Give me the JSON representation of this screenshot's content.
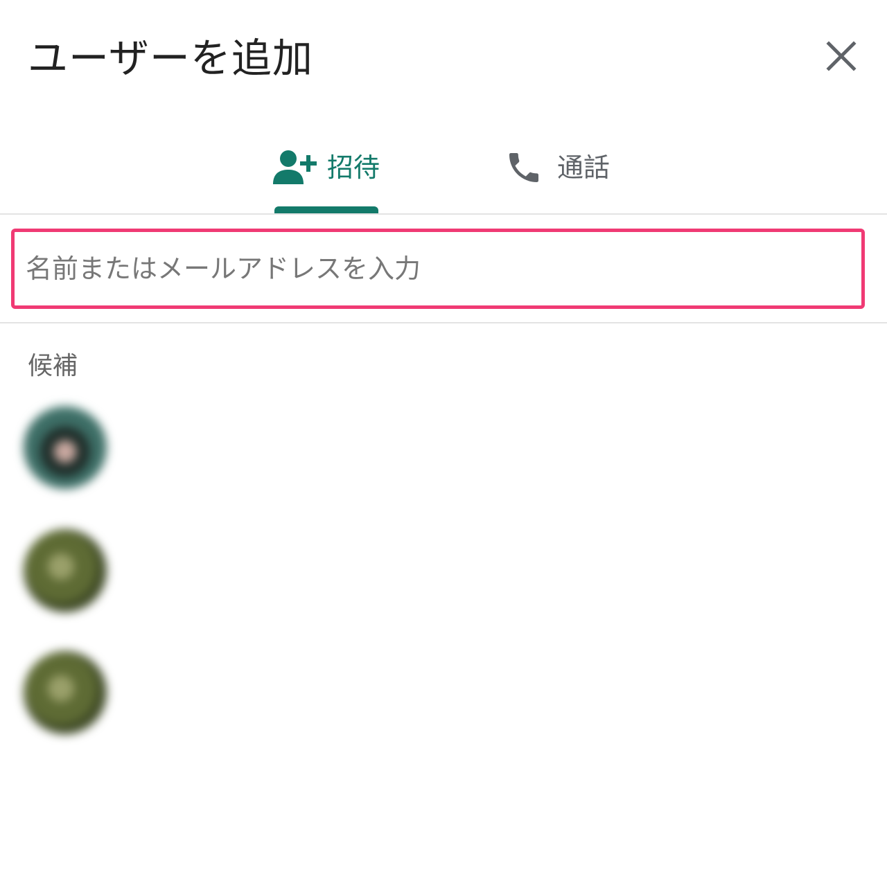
{
  "dialog": {
    "title": "ユーザーを追加",
    "close_icon": "close-icon"
  },
  "tabs": [
    {
      "label": "招待",
      "icon": "person-add-icon",
      "active": true
    },
    {
      "label": "通話",
      "icon": "phone-icon",
      "active": false
    }
  ],
  "colors": {
    "accent": "#137a6a",
    "highlight_border": "#f03a74",
    "inactive": "#5f6368"
  },
  "search": {
    "placeholder": "名前またはメールアドレスを入力",
    "value": ""
  },
  "suggestions": {
    "label": "候補",
    "items": [
      {
        "name": "",
        "email": ""
      },
      {
        "name": "",
        "email": ""
      },
      {
        "name": "",
        "email": ""
      }
    ]
  }
}
